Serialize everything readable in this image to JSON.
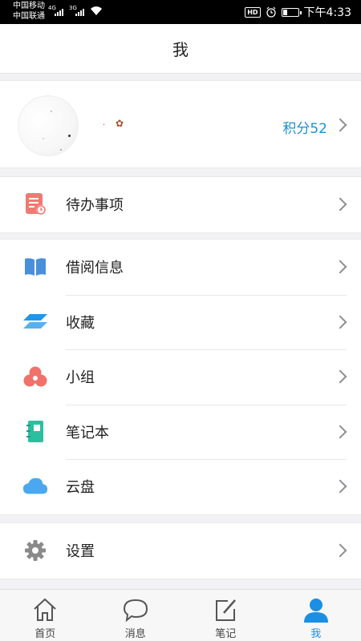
{
  "status_bar": {
    "carrier_1": "中国移动",
    "carrier_2": "中国联通",
    "network_1": "4G",
    "network_2": "3G",
    "hd": "HD",
    "time": "下午4:33"
  },
  "header": {
    "title": "我"
  },
  "profile": {
    "points": "积分52"
  },
  "menu": {
    "todo": {
      "label": "待办事项",
      "icon": "todo-icon",
      "color": "#ef7a74"
    },
    "borrow": {
      "label": "借阅信息",
      "icon": "book-icon",
      "color": "#4a90d9"
    },
    "favorites": {
      "label": "收藏",
      "icon": "layers-icon",
      "color": "#2196e8"
    },
    "group": {
      "label": "小组",
      "icon": "group-icon",
      "color": "#f0726a"
    },
    "notebook": {
      "label": "笔记本",
      "icon": "notebook-icon",
      "color": "#2bbf9f"
    },
    "cloud": {
      "label": "云盘",
      "icon": "cloud-icon",
      "color": "#4aa8f0"
    },
    "settings": {
      "label": "设置",
      "icon": "gear-icon",
      "color": "#8a8a8a"
    }
  },
  "tabbar": {
    "home": "首页",
    "messages": "消息",
    "notes": "笔记",
    "me": "我",
    "active": "me",
    "active_color": "#1a8fe3"
  }
}
